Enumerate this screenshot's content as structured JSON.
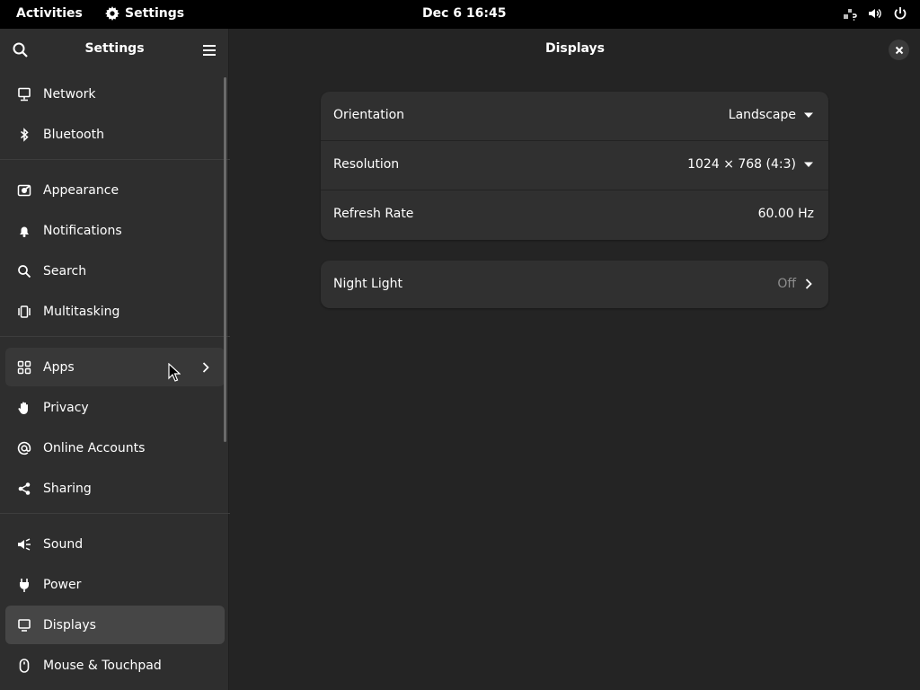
{
  "topbar": {
    "activities": "Activities",
    "app_name": "Settings",
    "clock": "Dec 6  16:45"
  },
  "sidebar": {
    "title": "Settings",
    "groups": [
      [
        {
          "label": "Network",
          "icon": "network-icon"
        },
        {
          "label": "Bluetooth",
          "icon": "bluetooth-icon"
        }
      ],
      [
        {
          "label": "Appearance",
          "icon": "appearance-icon"
        },
        {
          "label": "Notifications",
          "icon": "bell-icon"
        },
        {
          "label": "Search",
          "icon": "search-icon"
        },
        {
          "label": "Multitasking",
          "icon": "multitasking-icon"
        }
      ],
      [
        {
          "label": "Apps",
          "icon": "apps-grid-icon"
        },
        {
          "label": "Privacy",
          "icon": "hand-icon"
        },
        {
          "label": "Online Accounts",
          "icon": "at-sign-icon"
        },
        {
          "label": "Sharing",
          "icon": "share-icon"
        }
      ],
      [
        {
          "label": "Sound",
          "icon": "speaker-icon"
        },
        {
          "label": "Power",
          "icon": "plug-icon"
        },
        {
          "label": "Displays",
          "icon": "monitor-icon"
        },
        {
          "label": "Mouse & Touchpad",
          "icon": "mouse-icon"
        }
      ]
    ]
  },
  "content": {
    "title": "Displays",
    "display_card": {
      "orientation_label": "Orientation",
      "orientation_value": "Landscape",
      "resolution_label": "Resolution",
      "resolution_value": "1024 × 768 (4:3)",
      "refresh_label": "Refresh Rate",
      "refresh_value": "60.00 Hz"
    },
    "night_light_card": {
      "label": "Night Light",
      "value": "Off"
    }
  },
  "colors": {
    "sidebar_bg": "#2e2e2e",
    "content_bg": "#242424",
    "card_bg": "#303030",
    "selected_bg": "#464646",
    "topbar_bg": "#000000"
  }
}
